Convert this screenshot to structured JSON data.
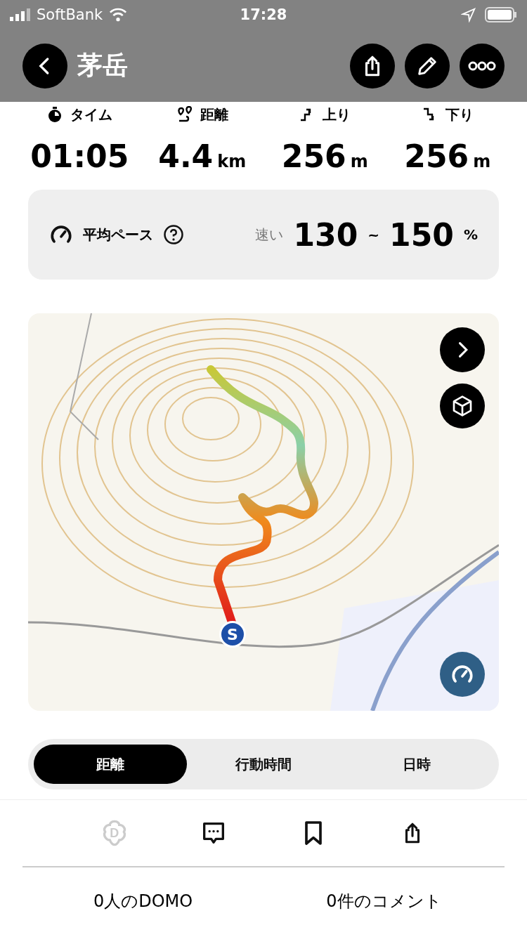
{
  "status_bar": {
    "carrier": "SoftBank",
    "time": "17:28"
  },
  "header": {
    "title": "茅岳"
  },
  "stats": [
    {
      "kind": "time",
      "label": "タイム",
      "value": "01:05"
    },
    {
      "kind": "distance",
      "label": "距離",
      "value": "4.4",
      "unit": "km"
    },
    {
      "kind": "ascent",
      "label": "上り",
      "value": "256",
      "unit": "m"
    },
    {
      "kind": "descent",
      "label": "下り",
      "value": "256",
      "unit": "m"
    }
  ],
  "pace": {
    "label": "平均ペース",
    "speed_label": "速い",
    "min": "130",
    "separator": "~",
    "max": "150",
    "unit": "%"
  },
  "map": {
    "start_marker": "S"
  },
  "tabs": [
    {
      "label": "距離",
      "selected": true
    },
    {
      "label": "行動時間",
      "selected": false
    },
    {
      "label": "日時",
      "selected": false
    }
  ],
  "toolbar": [
    {
      "kind": "domo",
      "glyph": "D",
      "active": false
    },
    {
      "kind": "comment"
    },
    {
      "kind": "bookmark"
    },
    {
      "kind": "share"
    }
  ],
  "counts": [
    "0人のDOMO",
    "0件のコメント"
  ]
}
